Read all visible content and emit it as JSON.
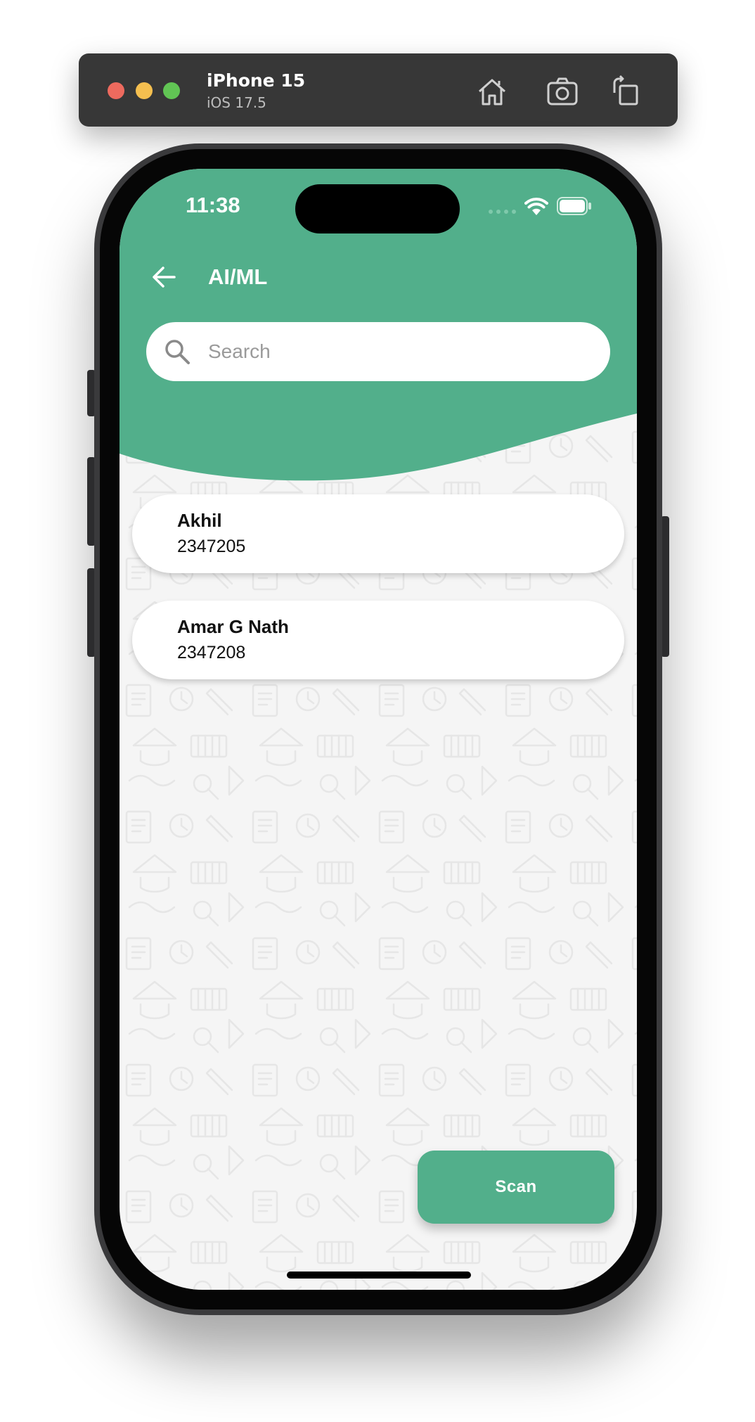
{
  "simulator": {
    "device_name": "iPhone 15",
    "os_version": "iOS 17.5",
    "toolbar_icons": [
      "home-icon",
      "screenshot-icon",
      "rotate-icon"
    ]
  },
  "status_bar": {
    "time": "11:38",
    "icons": [
      "signal-dots-icon",
      "wifi-icon",
      "battery-icon"
    ]
  },
  "header": {
    "back_icon": "arrow-left-icon",
    "title": "AI/ML"
  },
  "search": {
    "placeholder": "Search",
    "value": ""
  },
  "students": [
    {
      "name": "Akhil",
      "id": "2347205"
    },
    {
      "name": "Amar G Nath",
      "id": "2347208"
    }
  ],
  "actions": {
    "scan_label": "Scan"
  },
  "colors": {
    "accent": "#52af8b",
    "background": "#f5f5f5",
    "card": "#ffffff"
  }
}
